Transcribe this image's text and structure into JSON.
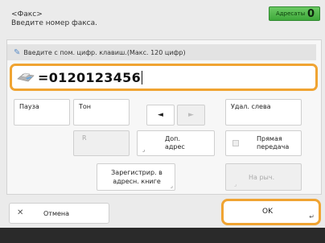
{
  "header": {
    "title": "<Факс>",
    "subtitle": "Введите номер факса."
  },
  "recipients": {
    "label": "Адресаты",
    "count": "0"
  },
  "input": {
    "hint": "Введите с пом. цифр. клавиш.(Макс. 120 цифр)",
    "value": "=0120123456"
  },
  "buttons": {
    "pause": "Пауза",
    "tone": "Тон",
    "r": "R",
    "left_arrow": "◄",
    "right_arrow": "►",
    "delete_left": "Удал. слева",
    "extra_address": "Доп. адрес",
    "direct_send": "Прямая передача",
    "register_address_book": "Зарегистрир. в адресн. книге",
    "on_hook": "На рыч."
  },
  "footer_buttons": {
    "cancel": "Отмена",
    "ok": "OK"
  },
  "colors": {
    "accent_orange": "#f0a432",
    "recipients_green": "#4db648",
    "footer_bar": "#2a2a2a"
  }
}
